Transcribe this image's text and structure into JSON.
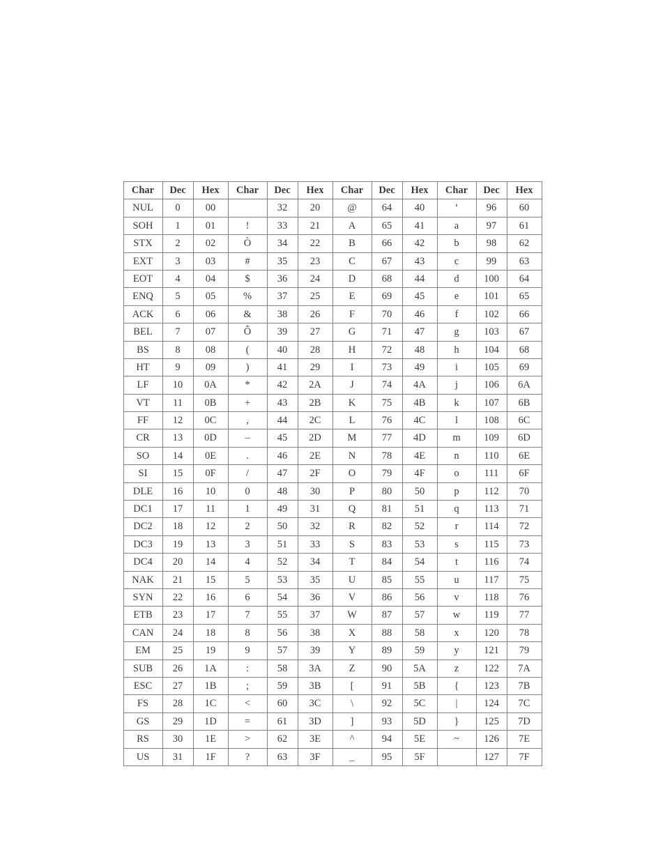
{
  "table": {
    "headers": [
      "Char",
      "Dec",
      "Hex",
      "Char",
      "Dec",
      "Hex",
      "Char",
      "Dec",
      "Hex",
      "Char",
      "Dec",
      "Hex"
    ],
    "rows": [
      [
        "NUL",
        "0",
        "00",
        "",
        "32",
        "20",
        "@",
        "64",
        "40",
        "‘",
        "96",
        "60"
      ],
      [
        "SOH",
        "1",
        "01",
        "!",
        "33",
        "21",
        "A",
        "65",
        "41",
        "a",
        "97",
        "61"
      ],
      [
        "STX",
        "2",
        "02",
        "Ò",
        "34",
        "22",
        "B",
        "66",
        "42",
        "b",
        "98",
        "62"
      ],
      [
        "EXT",
        "3",
        "03",
        "#",
        "35",
        "23",
        "C",
        "67",
        "43",
        "c",
        "99",
        "63"
      ],
      [
        "EOT",
        "4",
        "04",
        "$",
        "36",
        "24",
        "D",
        "68",
        "44",
        "d",
        "100",
        "64"
      ],
      [
        "ENQ",
        "5",
        "05",
        "%",
        "37",
        "25",
        "E",
        "69",
        "45",
        "e",
        "101",
        "65"
      ],
      [
        "ACK",
        "6",
        "06",
        "&",
        "38",
        "26",
        "F",
        "70",
        "46",
        "f",
        "102",
        "66"
      ],
      [
        "BEL",
        "7",
        "07",
        "Ô",
        "39",
        "27",
        "G",
        "71",
        "47",
        "g",
        "103",
        "67"
      ],
      [
        "BS",
        "8",
        "08",
        "(",
        "40",
        "28",
        "H",
        "72",
        "48",
        "h",
        "104",
        "68"
      ],
      [
        "HT",
        "9",
        "09",
        ")",
        "41",
        "29",
        "I",
        "73",
        "49",
        "i",
        "105",
        "69"
      ],
      [
        "LF",
        "10",
        "0A",
        "*",
        "42",
        "2A",
        "J",
        "74",
        "4A",
        "j",
        "106",
        "6A"
      ],
      [
        "VT",
        "11",
        "0B",
        "+",
        "43",
        "2B",
        "K",
        "75",
        "4B",
        "k",
        "107",
        "6B"
      ],
      [
        "FF",
        "12",
        "0C",
        ",",
        "44",
        "2C",
        "L",
        "76",
        "4C",
        "l",
        "108",
        "6C"
      ],
      [
        "CR",
        "13",
        "0D",
        "–",
        "45",
        "2D",
        "M",
        "77",
        "4D",
        "m",
        "109",
        "6D"
      ],
      [
        "SO",
        "14",
        "0E",
        ".",
        "46",
        "2E",
        "N",
        "78",
        "4E",
        "n",
        "110",
        "6E"
      ],
      [
        "SI",
        "15",
        "0F",
        "/",
        "47",
        "2F",
        "O",
        "79",
        "4F",
        "o",
        "111",
        "6F"
      ],
      [
        "DLE",
        "16",
        "10",
        "0",
        "48",
        "30",
        "P",
        "80",
        "50",
        "p",
        "112",
        "70"
      ],
      [
        "DC1",
        "17",
        "11",
        "1",
        "49",
        "31",
        "Q",
        "81",
        "51",
        "q",
        "113",
        "71"
      ],
      [
        "DC2",
        "18",
        "12",
        "2",
        "50",
        "32",
        "R",
        "82",
        "52",
        "r",
        "114",
        "72"
      ],
      [
        "DC3",
        "19",
        "13",
        "3",
        "51",
        "33",
        "S",
        "83",
        "53",
        "s",
        "115",
        "73"
      ],
      [
        "DC4",
        "20",
        "14",
        "4",
        "52",
        "34",
        "T",
        "84",
        "54",
        "t",
        "116",
        "74"
      ],
      [
        "NAK",
        "21",
        "15",
        "5",
        "53",
        "35",
        "U",
        "85",
        "55",
        "u",
        "117",
        "75"
      ],
      [
        "SYN",
        "22",
        "16",
        "6",
        "54",
        "36",
        "V",
        "86",
        "56",
        "v",
        "118",
        "76"
      ],
      [
        "ETB",
        "23",
        "17",
        "7",
        "55",
        "37",
        "W",
        "87",
        "57",
        "w",
        "119",
        "77"
      ],
      [
        "CAN",
        "24",
        "18",
        "8",
        "56",
        "38",
        "X",
        "88",
        "58",
        "x",
        "120",
        "78"
      ],
      [
        "EM",
        "25",
        "19",
        "9",
        "57",
        "39",
        "Y",
        "89",
        "59",
        "y",
        "121",
        "79"
      ],
      [
        "SUB",
        "26",
        "1A",
        ":",
        "58",
        "3A",
        "Z",
        "90",
        "5A",
        "z",
        "122",
        "7A"
      ],
      [
        "ESC",
        "27",
        "1B",
        ";",
        "59",
        "3B",
        "[",
        "91",
        "5B",
        "{",
        "123",
        "7B"
      ],
      [
        "FS",
        "28",
        "1C",
        "<",
        "60",
        "3C",
        "\\",
        "92",
        "5C",
        "|",
        "124",
        "7C"
      ],
      [
        "GS",
        "29",
        "1D",
        "=",
        "61",
        "3D",
        "]",
        "93",
        "5D",
        "}",
        "125",
        "7D"
      ],
      [
        "RS",
        "30",
        "1E",
        ">",
        "62",
        "3E",
        "^",
        "94",
        "5E",
        "~",
        "126",
        "7E"
      ],
      [
        "US",
        "31",
        "1F",
        "?",
        "63",
        "3F",
        "_",
        "95",
        "5F",
        "",
        "127",
        "7F"
      ]
    ]
  }
}
